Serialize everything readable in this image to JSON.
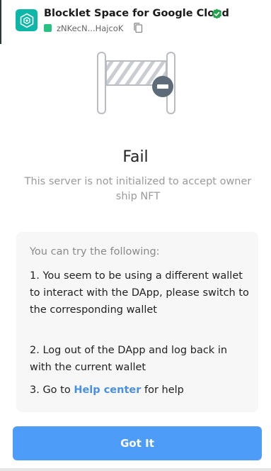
{
  "header": {
    "app_title": "Blocklet Space for Google Cloud",
    "did_short": "zNKecN...HajcoK",
    "logo_icon": "hexagon-logo-icon",
    "verified_icon": "verified-badge-icon",
    "copy_icon": "copy-icon"
  },
  "result": {
    "title": "Fail",
    "message": "This server is not initialized to accept owner ship NFT",
    "illustration": "closed-gate-icon"
  },
  "suggestions": {
    "title": "You can try the following:",
    "items": {
      "item1": "1. You seem to be using a different wallet to interact with the DApp, please switch to the corresponding wallet",
      "item2": "2. Log out of the DApp and log back in with the current wallet",
      "item3_prefix": "3. Go to ",
      "item3_link": "Help center",
      "item3_suffix": " for help"
    }
  },
  "actions": {
    "confirm_label": "Got It"
  },
  "colors": {
    "accent": "#4d9cf8",
    "link": "#4a90e2",
    "logo": "#0db7a7",
    "verified": "#1fa64a"
  }
}
